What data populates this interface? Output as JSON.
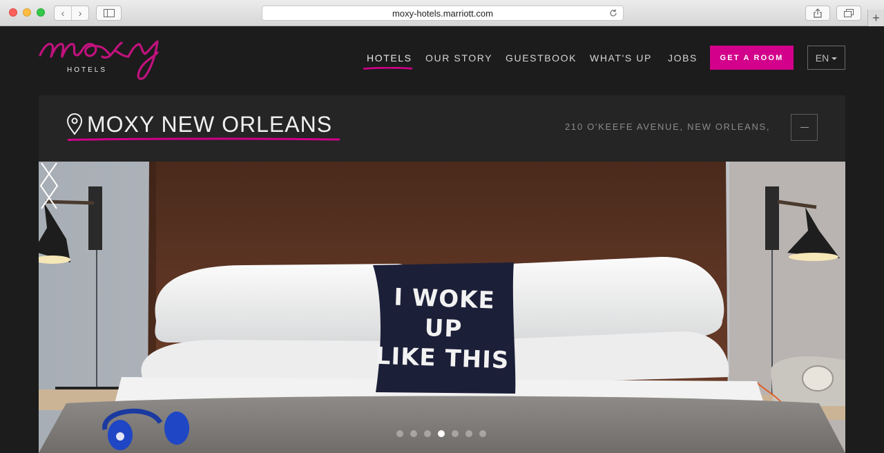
{
  "browser": {
    "url": "moxy-hotels.marriott.com"
  },
  "header": {
    "logo_sub": "HOTELS",
    "nav": [
      {
        "label": "HOTELS",
        "active": true
      },
      {
        "label": "OUR STORY"
      },
      {
        "label": "GUESTBOOK"
      },
      {
        "label": "WHAT'S UP"
      },
      {
        "label": "JOBS"
      }
    ],
    "cta_label": "GET A ROOM",
    "language": "EN",
    "brand_color": "#d2008a"
  },
  "hotel": {
    "name": "MOXY NEW ORLEANS",
    "address": "210 O'KEEFE AVENUE, NEW ORLEANS,"
  },
  "hero": {
    "pillow_lines": [
      "I WOKE",
      "UP",
      "LIKE THIS"
    ],
    "slides": 7,
    "active_slide": 4
  }
}
